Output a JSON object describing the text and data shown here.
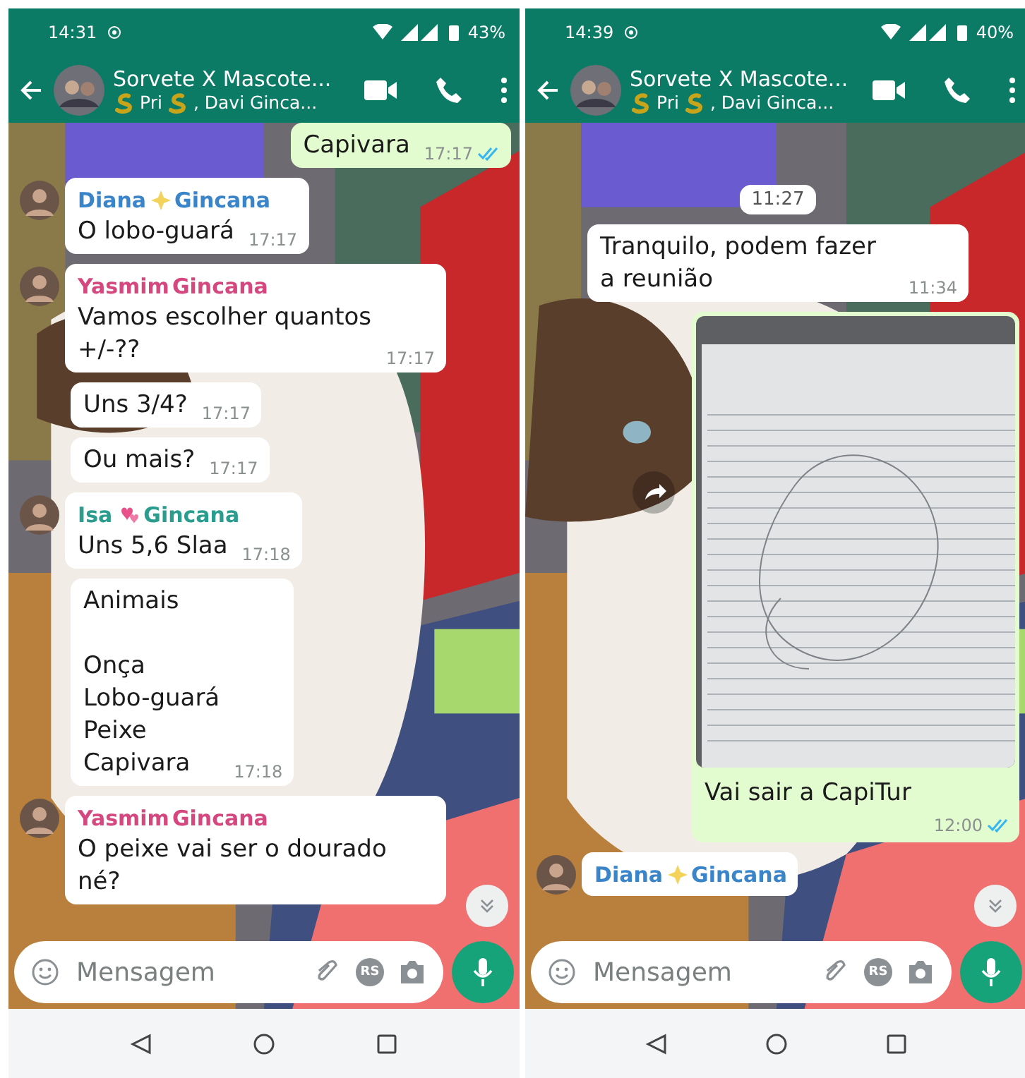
{
  "phones": [
    {
      "status_bar": {
        "time": "14:31",
        "battery": "43%"
      },
      "header": {
        "title": "Sorvete X Mascote...",
        "subtitle": [
          {
            "kind": "snake"
          },
          {
            "kind": "text",
            "text": "Pri"
          },
          {
            "kind": "snake"
          },
          {
            "kind": "text",
            "text": ", Davi Ginca..."
          }
        ]
      },
      "messages": [
        {
          "kind": "outgoing",
          "text": "Capivara",
          "time": "17:17",
          "read": true
        },
        {
          "kind": "incoming",
          "sender": {
            "name": "Diana",
            "kind": "sparkle",
            "suffix": "Gincana",
            "color": "#3a84c9"
          },
          "text": "O lobo-guará",
          "time": "17:17"
        },
        {
          "kind": "incoming",
          "sender": {
            "name": "Yasmim",
            "suffix": "Gincana",
            "color": "#d4477f"
          },
          "text": "Vamos escolher quantos +/-??",
          "time": "17:17"
        },
        {
          "kind": "incoming",
          "text": "Uns 3/4?",
          "time": "17:17"
        },
        {
          "kind": "incoming",
          "text": "Ou mais?",
          "time": "17:17"
        },
        {
          "kind": "incoming",
          "sender": {
            "name": "Isa",
            "kind": "hearts",
            "suffix": "Gincana",
            "color": "#2a9d8f"
          },
          "text": "Uns 5,6 Slaa",
          "time": "17:18"
        },
        {
          "kind": "incoming",
          "text": "Animais\n\nOnça\nLobo-guará\nPeixe\nCapivara",
          "time": "17:18"
        },
        {
          "kind": "incoming",
          "sender": {
            "name": "Yasmim",
            "suffix": "Gincana",
            "color": "#d4477f"
          },
          "text": "O peixe vai ser o dourado né?"
        }
      ],
      "composer": {
        "placeholder": "Mensagem",
        "sticker_badge": "RS"
      }
    },
    {
      "status_bar": {
        "time": "14:39",
        "battery": "40%"
      },
      "header": {
        "title": "Sorvete X Mascote...",
        "subtitle": [
          {
            "kind": "snake"
          },
          {
            "kind": "text",
            "text": "Pri"
          },
          {
            "kind": "snake"
          },
          {
            "kind": "text",
            "text": ", Davi Ginca..."
          }
        ]
      },
      "messages": [
        {
          "kind": "time_chip",
          "text": "11:27"
        },
        {
          "kind": "incoming",
          "text": "Tranquilo, podem fazer a reunião",
          "time": "11:34"
        },
        {
          "caption": "Vai sair a CapiTur",
          "time": "12:00",
          "read": true
        },
        {
          "kind": "incoming",
          "sender": {
            "name": "Diana",
            "kind": "sparkle",
            "suffix": "Gincana",
            "color": "#3a84c9"
          }
        }
      ],
      "composer": {
        "placeholder": "Mensagem",
        "sticker_badge": "RS"
      }
    }
  ]
}
